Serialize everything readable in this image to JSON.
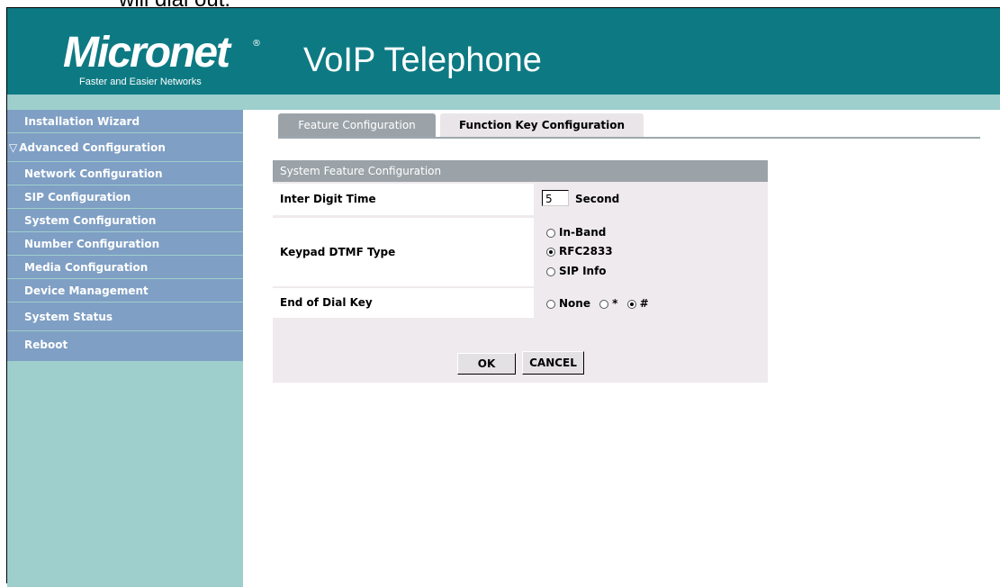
{
  "doc_snippet": "will dial out.",
  "brand": {
    "logo": "Micronet",
    "tagline": "Faster and Easier Networks",
    "app_title": "VoIP Telephone"
  },
  "sidebar": {
    "items": [
      {
        "label": "Installation Wizard"
      },
      {
        "label": "Advanced Configuration",
        "expanded": true
      },
      {
        "label": "Network Configuration"
      },
      {
        "label": "SIP Configuration"
      },
      {
        "label": "System Configuration"
      },
      {
        "label": "Number Configuration"
      },
      {
        "label": "Media Configuration"
      },
      {
        "label": "Device Management"
      },
      {
        "label": "System Status"
      },
      {
        "label": "Reboot"
      }
    ]
  },
  "tabs": [
    {
      "label": "Feature Configuration",
      "active": true
    },
    {
      "label": "Function Key Configuration",
      "active": false
    }
  ],
  "panel": {
    "title": "System Feature Configuration",
    "inter_digit": {
      "label": "Inter Digit Time",
      "value": "5",
      "unit": "Second"
    },
    "dtmf": {
      "label": "Keypad DTMF Type",
      "options": [
        "In-Band",
        "RFC2833",
        "SIP Info"
      ],
      "selected": "RFC2833"
    },
    "end_key": {
      "label": "End of Dial Key",
      "options": [
        "None",
        "*",
        "#"
      ],
      "selected": "#"
    }
  },
  "buttons": {
    "ok": "OK",
    "cancel": "CANCEL"
  },
  "colors": {
    "header": "#0d7a83",
    "sidebar": "#9ecfcc",
    "nav_item": "#7f9fc4",
    "panel": "#efeaed",
    "panel_head": "#9ba3a9"
  }
}
